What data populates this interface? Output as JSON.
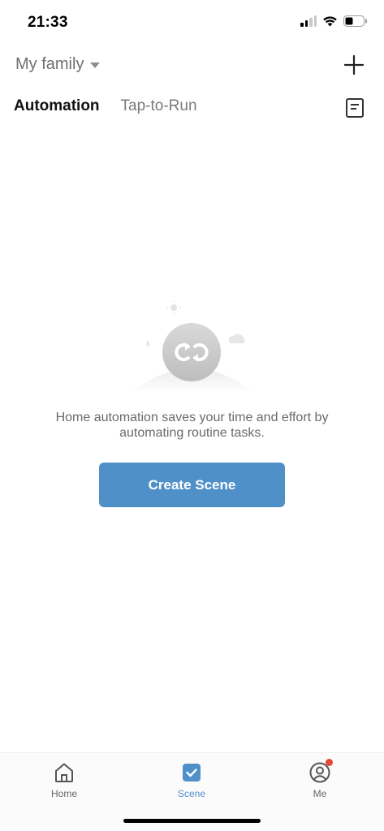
{
  "status_bar": {
    "time": "21:33"
  },
  "header": {
    "family_name": "My family",
    "icons": {
      "add": "plus-icon",
      "log": "log-icon",
      "dropdown": "caret-down-icon"
    }
  },
  "tabs": [
    {
      "label": "Automation",
      "active": true
    },
    {
      "label": "Tap-to-Run",
      "active": false
    }
  ],
  "empty_state": {
    "illustration": "automation-loop-icon",
    "message": "Home automation saves your time and effort by automating routine tasks.",
    "button_label": "Create Scene"
  },
  "bottom_nav": [
    {
      "label": "Home",
      "icon": "home-icon",
      "active": false
    },
    {
      "label": "Scene",
      "icon": "scene-check-icon",
      "active": true
    },
    {
      "label": "Me",
      "icon": "profile-icon",
      "active": false,
      "badge": true
    }
  ],
  "colors": {
    "accent": "#4f90c9",
    "badge": "#e8453c",
    "muted_text": "#6a6a6a"
  }
}
